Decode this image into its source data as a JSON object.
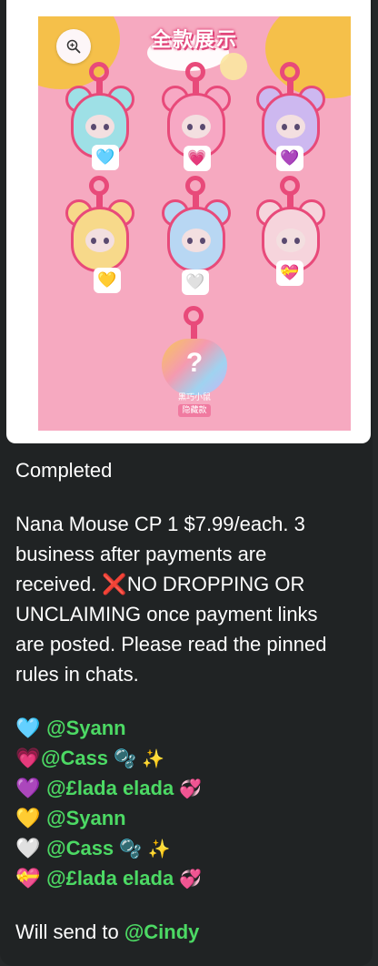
{
  "poster": {
    "title": "全款展示",
    "mystery_mark": "?",
    "mystery_label_1": "黑巧小鼠",
    "mystery_label_2": "隐藏款",
    "figures": [
      {
        "heart": "🩵",
        "fur": "#9ee0e6"
      },
      {
        "heart": "💗",
        "fur": "#f7a8c4"
      },
      {
        "heart": "💜",
        "fur": "#cdb8f0"
      },
      {
        "heart": "💛",
        "fur": "#f7d98a"
      },
      {
        "heart": "🤍",
        "fur": "#b8d7f3"
      },
      {
        "heart": "💝",
        "fur": "#f6d4dc"
      }
    ]
  },
  "message": {
    "status": "Completed",
    "body_lines": [
      "Nana Mouse CP 1 $7.99/each. 3",
      "business after payments are",
      "received.",
      "NO DROPPING OR",
      "UNCLAIMING once payment links",
      "are posted. Please read the pinned",
      "rules in chats."
    ],
    "cross_icon": "❌",
    "claims": [
      {
        "heart": "🩵",
        "handle": "@Syann",
        "suffix": ""
      },
      {
        "heart": "💗",
        "handle": "@Cass",
        "suffix": "🫧 ✨"
      },
      {
        "heart": "💜",
        "handle": "@£lada elada",
        "suffix": "💞"
      },
      {
        "heart": "💛",
        "handle": "@Syann",
        "suffix": ""
      },
      {
        "heart": "🤍",
        "handle": "@Cass",
        "suffix": "🫧 ✨"
      },
      {
        "heart": "💝",
        "handle": "@£lada elada",
        "suffix": "💞"
      }
    ],
    "send_prefix": "Will send to",
    "send_handle": "@Cindy"
  },
  "colors": {
    "background": "#202324",
    "mention": "#4cd964",
    "poster_pink": "#f6a9c0"
  }
}
